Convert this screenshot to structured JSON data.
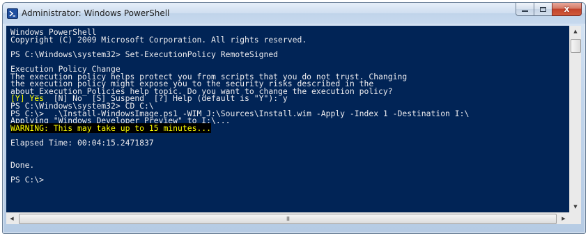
{
  "window": {
    "title": "Administrator: Windows PowerShell",
    "close_label": "x"
  },
  "console": {
    "lines": [
      {
        "text": "Windows PowerShell"
      },
      {
        "text": "Copyright (C) 2009 Microsoft Corporation. All rights reserved."
      },
      {
        "text": ""
      },
      {
        "text": "PS C:\\Windows\\system32> Set-ExecutionPolicy RemoteSigned"
      },
      {
        "text": ""
      },
      {
        "text": "Execution Policy Change"
      },
      {
        "text": "The execution policy helps protect you from scripts that you do not trust. Changing"
      },
      {
        "text": "the execution policy might expose you to the security risks described in the"
      },
      {
        "text": "about_Execution_Policies help topic. Do you want to change the execution policy?"
      },
      {
        "text": "[N] No  [S] Suspend  [?] Help (default is \"Y\"): y",
        "prefix": "[Y] Yes  "
      },
      {
        "text": "PS C:\\Windows\\system32> CD C:\\"
      },
      {
        "text": "PS C:\\>  .\\Install-WindowsImage.ps1 -WIM J:\\Sources\\Install.wim -Apply -Index 1 -Destination I:\\"
      },
      {
        "text": "Applying \"Windows Developer Preview\" to I:\\..."
      },
      {
        "text": "WARNING: This may take up to 15 minutes...",
        "style": "warn"
      },
      {
        "text": ""
      },
      {
        "text": "Elapsed Time: 00:04:15.2471837"
      },
      {
        "text": ""
      },
      {
        "text": ""
      },
      {
        "text": "Done."
      },
      {
        "text": ""
      },
      {
        "text": "PS C:\\>"
      }
    ]
  },
  "scrollbars": {
    "up_arrow": "▲",
    "down_arrow": "▼",
    "left_arrow": "◀",
    "right_arrow": "▶",
    "h_thumb_grip": "III"
  },
  "colors": {
    "console_bg": "#012456",
    "console_fg": "#eeedf0",
    "warning_fg": "#ffff00",
    "warning_bg": "#000000"
  },
  "icons": {
    "app": "powershell-icon",
    "minimize": "minimize-icon",
    "maximize": "maximize-icon",
    "close": "close-icon"
  }
}
